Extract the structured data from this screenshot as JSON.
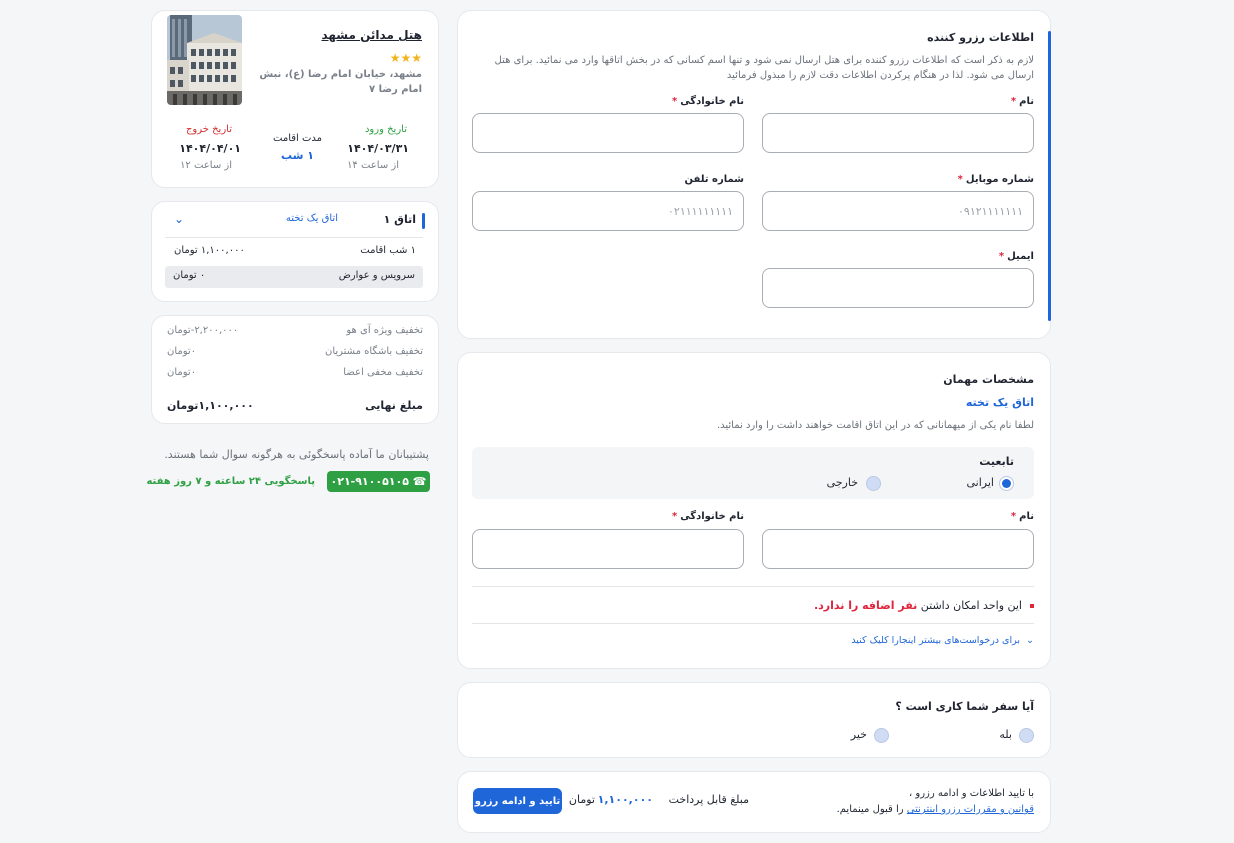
{
  "booker": {
    "title": "اطلاعات رزرو کننده",
    "description": "لازم به ذکر است که اطلاعات رزرو کننده برای هتل ارسال نمی شود و تنها اسم کسانی که در بخش اتاقها وارد می نمائید. برای هتل ارسال می شود. لذا در هنگام پرکردن اطلاعات دقت لازم را مبذول فرمائید",
    "first_name_label": "نام",
    "last_name_label": "نام خانوادگی",
    "mobile_label": "شماره موبایل",
    "mobile_placeholder": "۰۹۱۲۱۱۱۱۱۱۱",
    "phone_label": "شماره تلفن",
    "phone_placeholder": "۰۲۱۱۱۱۱۱۱۱۱",
    "email_label": "ایمیل",
    "required_mark": "*"
  },
  "guest": {
    "title": "مشخصات مهمان",
    "room_name": "اتاق یک تخته",
    "description": "لطفا نام یکی از میهمانانی که در این اتاق اقامت خواهند داشت را وارد نمائید.",
    "nationality_label": "تابعیت",
    "nationality_iranian": "ایرانی",
    "nationality_foreign": "خارجی",
    "first_name_label": "نام",
    "last_name_label": "نام خانوادگی",
    "notice_prefix": "این واحد امکان داشتن",
    "notice_highlight": "نفر اضافه را ندارد.",
    "more_requests": "برای درخواست‌های بیشتر اینجارا کلیک کنید"
  },
  "business": {
    "question": "آیا سفر شما کاری است ؟",
    "yes": "بله",
    "no": "خیر"
  },
  "footer": {
    "terms_line1": "با تایید اطلاعات و ادامه رزرو ،",
    "terms_link": "قوانین و مقررات رزرو اینترنتی",
    "terms_line2_suffix": "را قبول مینمایم.",
    "payable_label": "مبلغ قابل پرداخت",
    "payable_amount": "۱,۱۰۰,۰۰۰",
    "currency": "تومان",
    "confirm_button": "تایید و ادامه رزرو"
  },
  "hotel": {
    "name": "هتل مدائن مشهد",
    "stars": "★★★",
    "address_line1": "مشهد، خیابان امام رضا (ع)، نبش",
    "address_line2": "امام رضا ۷",
    "checkin_label": "تاریخ ورود",
    "checkin_date": "۱۴۰۴/۰۳/۳۱",
    "checkin_time": "از ساعت ۱۴",
    "stay_label": "مدت اقامت",
    "stay_value": "۱ شب",
    "checkout_label": "تاریخ خروج",
    "checkout_date": "۱۴۰۴/۰۴/۰۱",
    "checkout_time": "از ساعت ۱۲"
  },
  "room": {
    "title": "اتاق ۱",
    "type": "اتاق یک تخته",
    "stay_row_label": "۱ شب اقامت",
    "stay_row_value": "۱,۱۰۰,۰۰۰ تومان",
    "tax_row_label": "سرویس و عوارض",
    "tax_row_value": "۰ تومان"
  },
  "discounts": {
    "rows": [
      {
        "label": "تخفیف ویژه آی هو",
        "value": "۲,۲۰۰,۰۰۰-تومان"
      },
      {
        "label": "تخفیف باشگاه مشتریان",
        "value": "۰تومان"
      },
      {
        "label": "تخفیف مخفی اعضا",
        "value": "۰تومان"
      }
    ],
    "final_label": "مبلغ نهایی",
    "final_value": "۱,۱۰۰,۰۰۰تومان"
  },
  "support": {
    "text": "پشتیبانان ما آماده پاسخگوئی به هرگونه سوال شما هستند.",
    "phone": "۰۲۱-۹۱۰۰۵۱۰۵",
    "hours": "پاسخگویی ۲۴ ساعته و ۷ روز هفته"
  },
  "colors": {
    "accent": "#1f66d8",
    "green": "#2ea043",
    "red": "#e0243c",
    "checkout_red": "#d0302f"
  }
}
